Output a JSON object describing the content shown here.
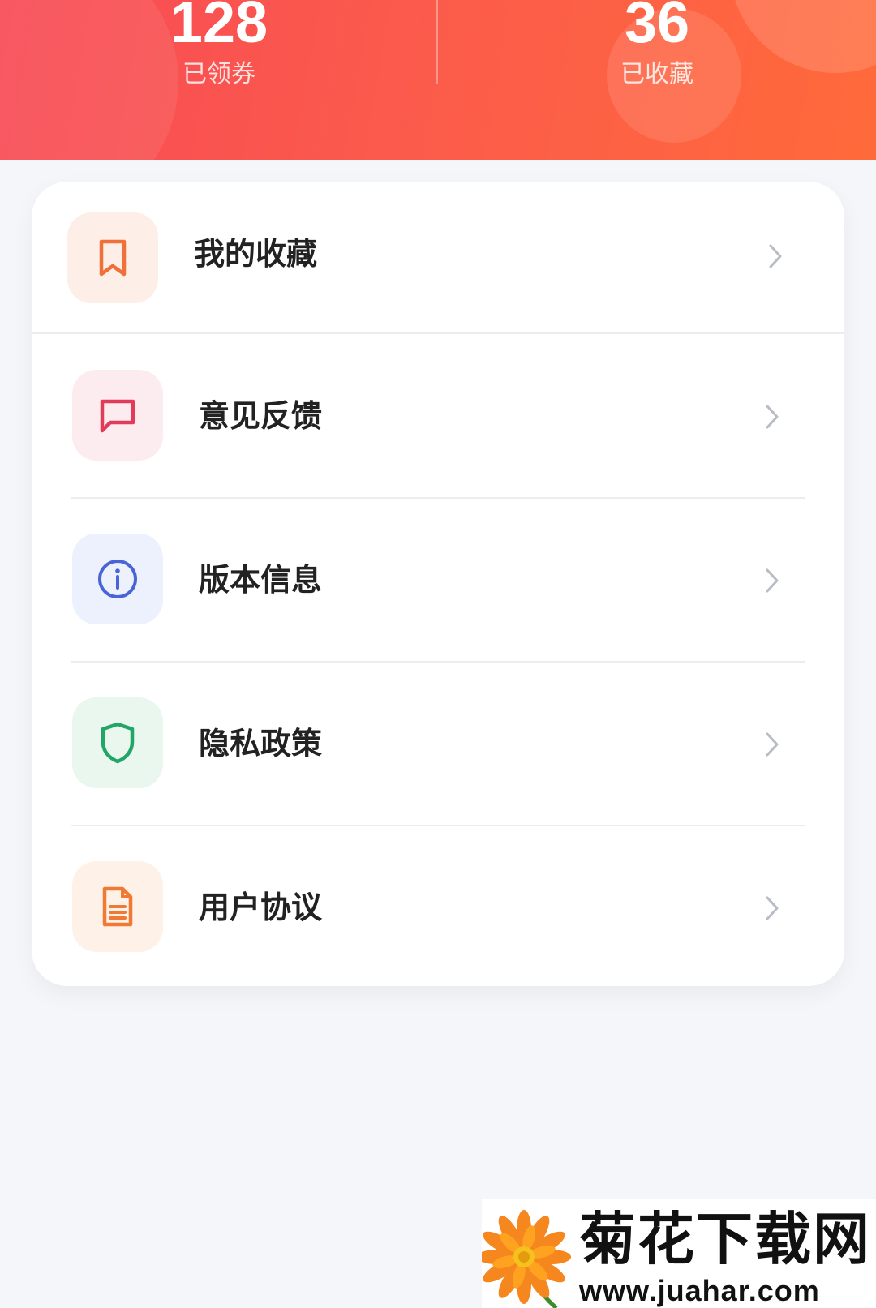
{
  "header": {
    "stats": [
      {
        "value": "128",
        "label": "已领券"
      },
      {
        "value": "36",
        "label": "已收藏"
      }
    ]
  },
  "menu": {
    "items": [
      {
        "label": "我的收藏",
        "icon": "bookmark-icon",
        "color": "#f0703a"
      },
      {
        "label": "意见反馈",
        "icon": "message-icon",
        "color": "#e23b5a"
      },
      {
        "label": "版本信息",
        "icon": "info-icon",
        "color": "#4a64d8"
      },
      {
        "label": "隐私政策",
        "icon": "shield-icon",
        "color": "#22a566"
      },
      {
        "label": "用户协议",
        "icon": "document-icon",
        "color": "#f07a33"
      }
    ]
  },
  "watermark": {
    "title": "菊花下载网",
    "url": "www.juahar.com"
  }
}
